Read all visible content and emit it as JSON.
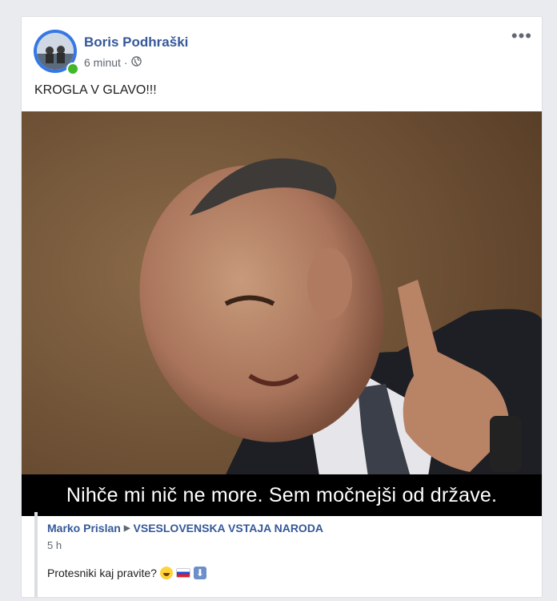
{
  "post": {
    "author_name": "Boris Podhraški",
    "time": "6 minut",
    "separator": "·",
    "privacy_icon": "globe-icon",
    "more_label": "•••",
    "text": "KROGLA V GLAVO!!!"
  },
  "photo": {
    "caption": "Nihče mi nič ne more. Sem močnejši od države."
  },
  "shared": {
    "author": "Marko Prislan",
    "target": "VSESLOVENSKA VSTAJA NARODA",
    "time": "5 h",
    "text": "Protesniki kaj pravite?",
    "emojis": [
      "laughing-emoji",
      "slovenia-flag-emoji",
      "down-arrow-emoji"
    ]
  },
  "colors": {
    "link": "#365899",
    "online": "#42b72a",
    "avatar_ring": "#3578e5"
  }
}
